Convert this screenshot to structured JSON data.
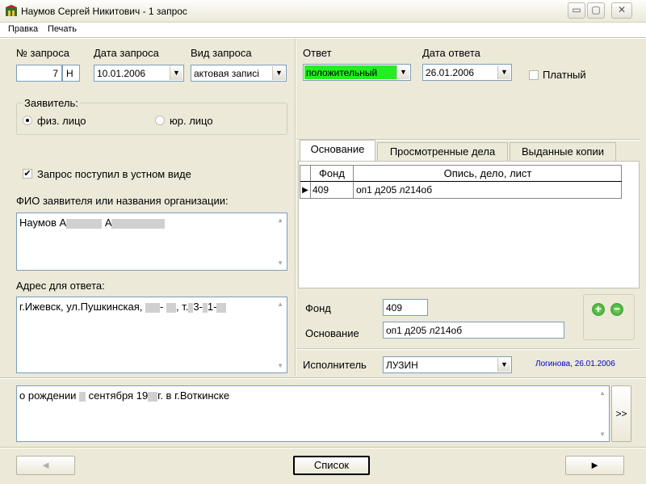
{
  "window": {
    "title": "Наумов Сергей Никитович - 1 запрос",
    "min_glyph": "▭",
    "max_glyph": "▢",
    "close_glyph": "✕"
  },
  "menu": {
    "items": [
      "Правка",
      "Печать"
    ]
  },
  "request": {
    "number_label": "№ запроса",
    "number_value": "7",
    "number_suffix": "Н",
    "date_label": "Дата запроса",
    "date_value": "10.01.2006",
    "type_label": "Вид запроса",
    "type_value": "актовая записі"
  },
  "applicant": {
    "group_label": "Заявитель:",
    "option_person": "физ. лицо",
    "option_org": "юр. лицо",
    "selected": "физ. лицо",
    "oral_label": "Запрос поступил в устном виде",
    "oral_checked": true,
    "name_label": "ФИО заявителя или названия организации:",
    "name_value_prefix": "Наумов А",
    "name_value_mid": "А",
    "address_label": "Адрес для ответа:",
    "address_prefix": "г.Ижевск, ул.Пушкинская,",
    "address_dash": "-",
    "address_t": ", т.",
    "address_3": "3-",
    "address_1": "1-"
  },
  "answer": {
    "answer_label": "Ответ",
    "answer_value": "положительный",
    "answer_color": "#22ee22",
    "date_label": "Дата ответа",
    "date_value": "26.01.2006",
    "paid_label": "Платный",
    "paid_checked": false
  },
  "tabs": [
    {
      "label": "Основание",
      "active": true
    },
    {
      "label": "Просмотренные дела",
      "active": false
    },
    {
      "label": "Выданные копии",
      "active": false
    }
  ],
  "grid": {
    "columns": [
      "Фонд",
      "Опись, дело, лист"
    ],
    "rows": [
      {
        "fond": "409",
        "detail": "оп1 д205 л214об"
      }
    ]
  },
  "detail_form": {
    "fond_label": "Фонд",
    "fond_value": "409",
    "basis_label": "Основание",
    "basis_value": "оп1 д205 л214об"
  },
  "executor": {
    "label": "Исполнитель",
    "value": "ЛУЗИН",
    "note": "Логинова, 26.01.2006",
    "note_color": "#0000cc"
  },
  "request_text": {
    "prefix": "о рождении",
    "mid": "сентября 19",
    "suffix": "г. в г.Воткинске",
    "expand_label": ">>"
  },
  "footer": {
    "prev_glyph": "◄",
    "list_label": "Список",
    "next_glyph": "►"
  }
}
